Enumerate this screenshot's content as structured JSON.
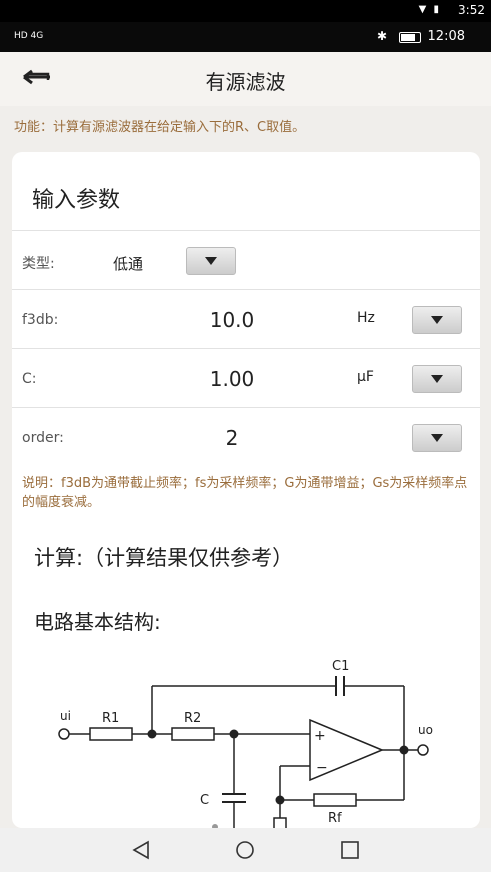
{
  "system": {
    "time": "3:52"
  },
  "status": {
    "network": "HD 4G",
    "clock": "12:08"
  },
  "header": {
    "title": "有源滤波",
    "back_icon": "back-arrow-icon"
  },
  "function_desc": "功能：计算有源滤波器在给定输入下的R、C取值。",
  "input": {
    "title": "输入参数",
    "rows": [
      {
        "label": "类型:",
        "value": "低通",
        "unit": ""
      },
      {
        "label": "f3db:",
        "value": "10.0",
        "unit": "Hz"
      },
      {
        "label": "C:",
        "value": "1.00",
        "unit": "µF"
      },
      {
        "label": "order:",
        "value": "2",
        "unit": ""
      }
    ]
  },
  "note": "说明：f3dB为通带截止频率；fs为采样频率；G为通带增益；Gs为采样频率点的幅度衰减。",
  "calc_title": "计算:（计算结果仅供参考）",
  "structure_title": "电路基本结构:",
  "circuit": {
    "ui": "ui",
    "uo": "uo",
    "r1": "R1",
    "r2": "R2",
    "c": "C",
    "c1": "C1",
    "rf": "Rf"
  }
}
